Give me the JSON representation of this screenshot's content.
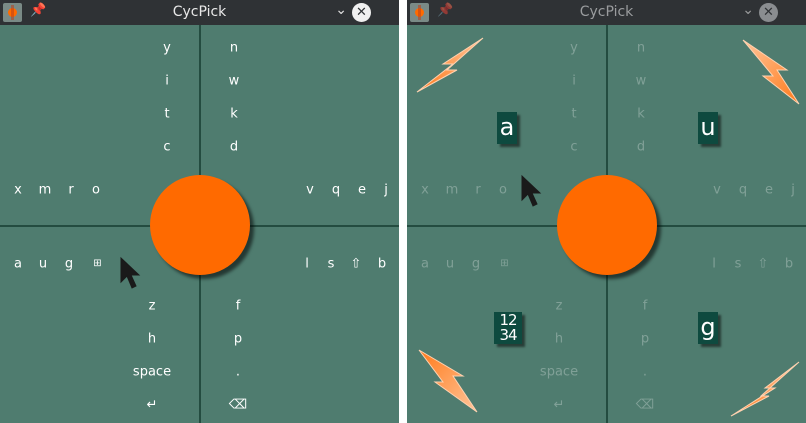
{
  "window_title": "CycPick",
  "title_icons": {
    "app": "cycpick-app-icon",
    "pin": "pin-icon",
    "menu": "chevron-down-icon",
    "close": "close-icon"
  },
  "glyphs": {
    "pin": "✈",
    "chevron": "∨",
    "close": "✕"
  },
  "keys": {
    "top_left": [
      "y",
      "i",
      "t",
      "c"
    ],
    "top_right": [
      "n",
      "w",
      "k",
      "d"
    ],
    "left_upper": [
      "x",
      "m",
      "r",
      "o"
    ],
    "right_upper": [
      "v",
      "q",
      "e",
      "j"
    ],
    "left_lower": [
      "a",
      "u",
      "g",
      "🈯"
    ],
    "right_lower": [
      "l",
      "s",
      "⇧",
      "b"
    ],
    "bottom_left": [
      "z",
      "h",
      "space",
      "↵"
    ],
    "bottom_right": [
      "f",
      "p",
      ".",
      "⌫"
    ]
  },
  "highlight": {
    "top_left": "a",
    "top_right": "u",
    "bottom_left": "1234",
    "bottom_right": "g"
  },
  "grid_glyph_rows": [
    "12",
    "34"
  ],
  "colors": {
    "background": "#4f7c6f",
    "titlebar": "#2f3235",
    "center_circle": "#ff6a00",
    "arrows": "#ff8a3a",
    "highlight_box": "#0e4a3f"
  }
}
